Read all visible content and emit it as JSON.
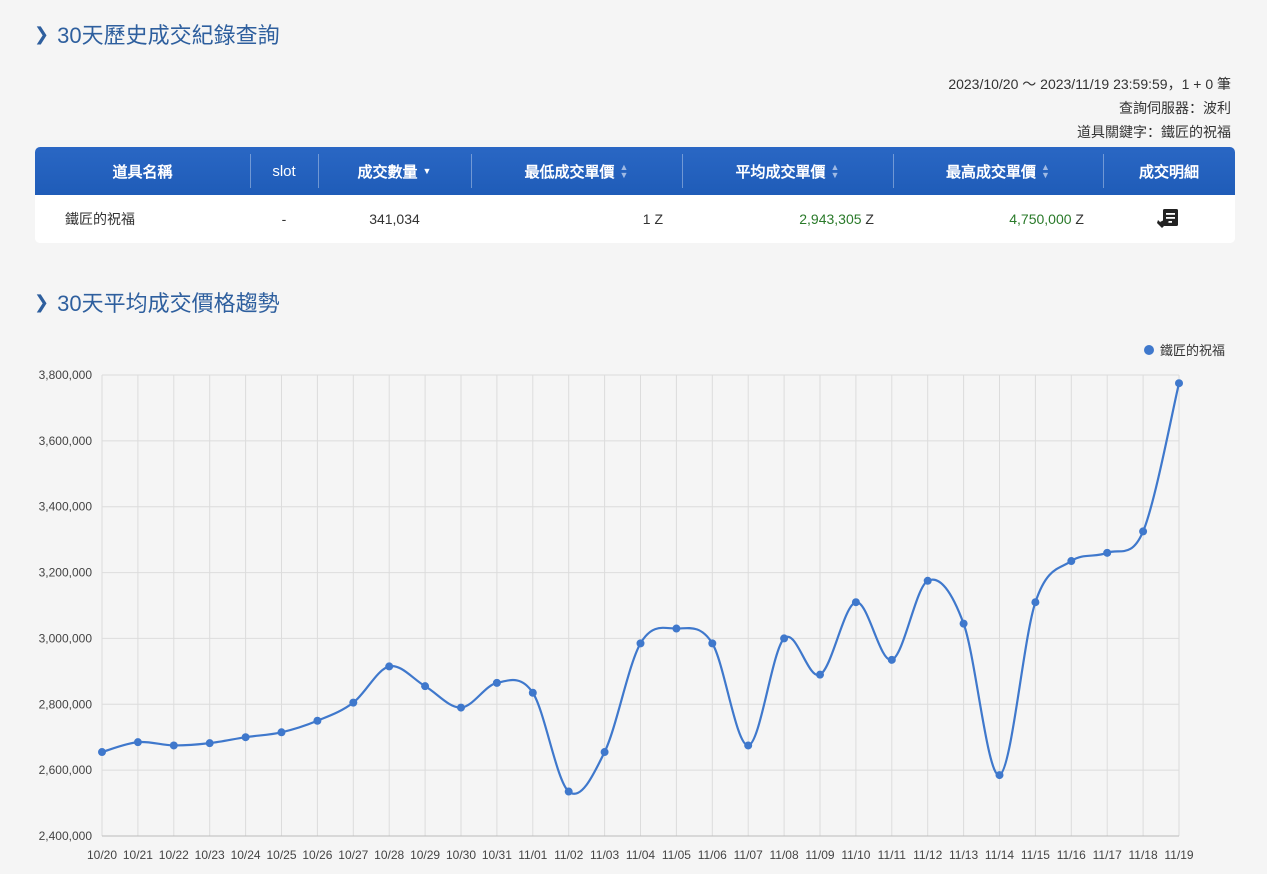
{
  "section1": {
    "title": "30天歷史成交紀錄查詢"
  },
  "meta": {
    "range": "2023/10/20 〜 2023/11/19 23:59:59，1 + 0 筆",
    "server": "查詢伺服器：波利",
    "keyword": "道具關鍵字：鐵匠的祝福"
  },
  "table": {
    "headers": {
      "name": "道具名稱",
      "slot": "slot",
      "qty": "成交數量",
      "min": "最低成交單價",
      "avg": "平均成交單價",
      "max": "最高成交單價",
      "detail": "成交明細"
    },
    "row": {
      "name": "鐵匠的祝福",
      "slot": "-",
      "qty": "341,034",
      "min": "1 Z",
      "avg": "2,943,305",
      "max": "4,750,000",
      "unit": " Z"
    },
    "detail_icon": "receipt-icon"
  },
  "section2": {
    "title": "30天平均成交價格趨勢"
  },
  "chart_data": {
    "type": "line",
    "legend_position": "top-right",
    "grid": true,
    "color": "#3f78cc",
    "ylim": [
      2400000,
      3800000
    ],
    "yticks": [
      "2,400,000",
      "2,600,000",
      "2,800,000",
      "3,000,000",
      "3,200,000",
      "3,400,000",
      "3,600,000",
      "3,800,000"
    ],
    "x": [
      "10/20",
      "10/21",
      "10/22",
      "10/23",
      "10/24",
      "10/25",
      "10/26",
      "10/27",
      "10/28",
      "10/29",
      "10/30",
      "10/31",
      "11/01",
      "11/02",
      "11/03",
      "11/04",
      "11/05",
      "11/06",
      "11/07",
      "11/08",
      "11/09",
      "11/10",
      "11/11",
      "11/12",
      "11/13",
      "11/14",
      "11/15",
      "11/16",
      "11/17",
      "11/18",
      "11/19"
    ],
    "series": [
      {
        "name": "鐵匠的祝福",
        "values": [
          2655000,
          2685000,
          2675000,
          2682000,
          2700000,
          2715000,
          2750000,
          2805000,
          2915000,
          2855000,
          2790000,
          2865000,
          2835000,
          2535000,
          2655000,
          2985000,
          3030000,
          2985000,
          2675000,
          3000000,
          2890000,
          3110000,
          2935000,
          3175000,
          3045000,
          2585000,
          3110000,
          3235000,
          3260000,
          3325000,
          3775000
        ]
      }
    ]
  }
}
